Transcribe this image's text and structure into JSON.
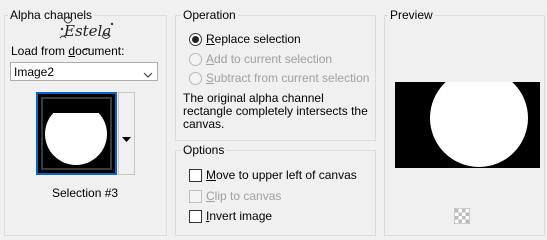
{
  "alpha": {
    "title": "Alpha channels",
    "load_prefix": "Load from ",
    "load_underlined": "d",
    "load_suffix": "ocument:",
    "select_value": "Image2",
    "thumb_caption": "Selection #3",
    "watermark": "Estela"
  },
  "operation": {
    "title": "Operation",
    "options": [
      {
        "u": "R",
        "rest": "eplace selection",
        "selected": true,
        "enabled": true
      },
      {
        "u": "A",
        "rest": "dd to current selection",
        "selected": false,
        "enabled": false
      },
      {
        "u": "S",
        "rest": "ubtract from current selection",
        "selected": false,
        "enabled": false
      }
    ],
    "note_lines": [
      "The original alpha channel",
      "rectangle completely intersects the",
      "canvas."
    ]
  },
  "options": {
    "title": "Options",
    "items": [
      {
        "u": "M",
        "rest": "ove to upper left of canvas",
        "checked": false,
        "enabled": true
      },
      {
        "u": "C",
        "rest": "lip to canvas",
        "checked": false,
        "enabled": false
      },
      {
        "u": "I",
        "rest": "nvert image",
        "checked": false,
        "enabled": true
      }
    ]
  },
  "preview": {
    "title": "Preview"
  },
  "colors": {
    "selection_border": "#0a64c8",
    "group_border": "#dcdcdc",
    "disabled_text": "#a0a0a0"
  }
}
